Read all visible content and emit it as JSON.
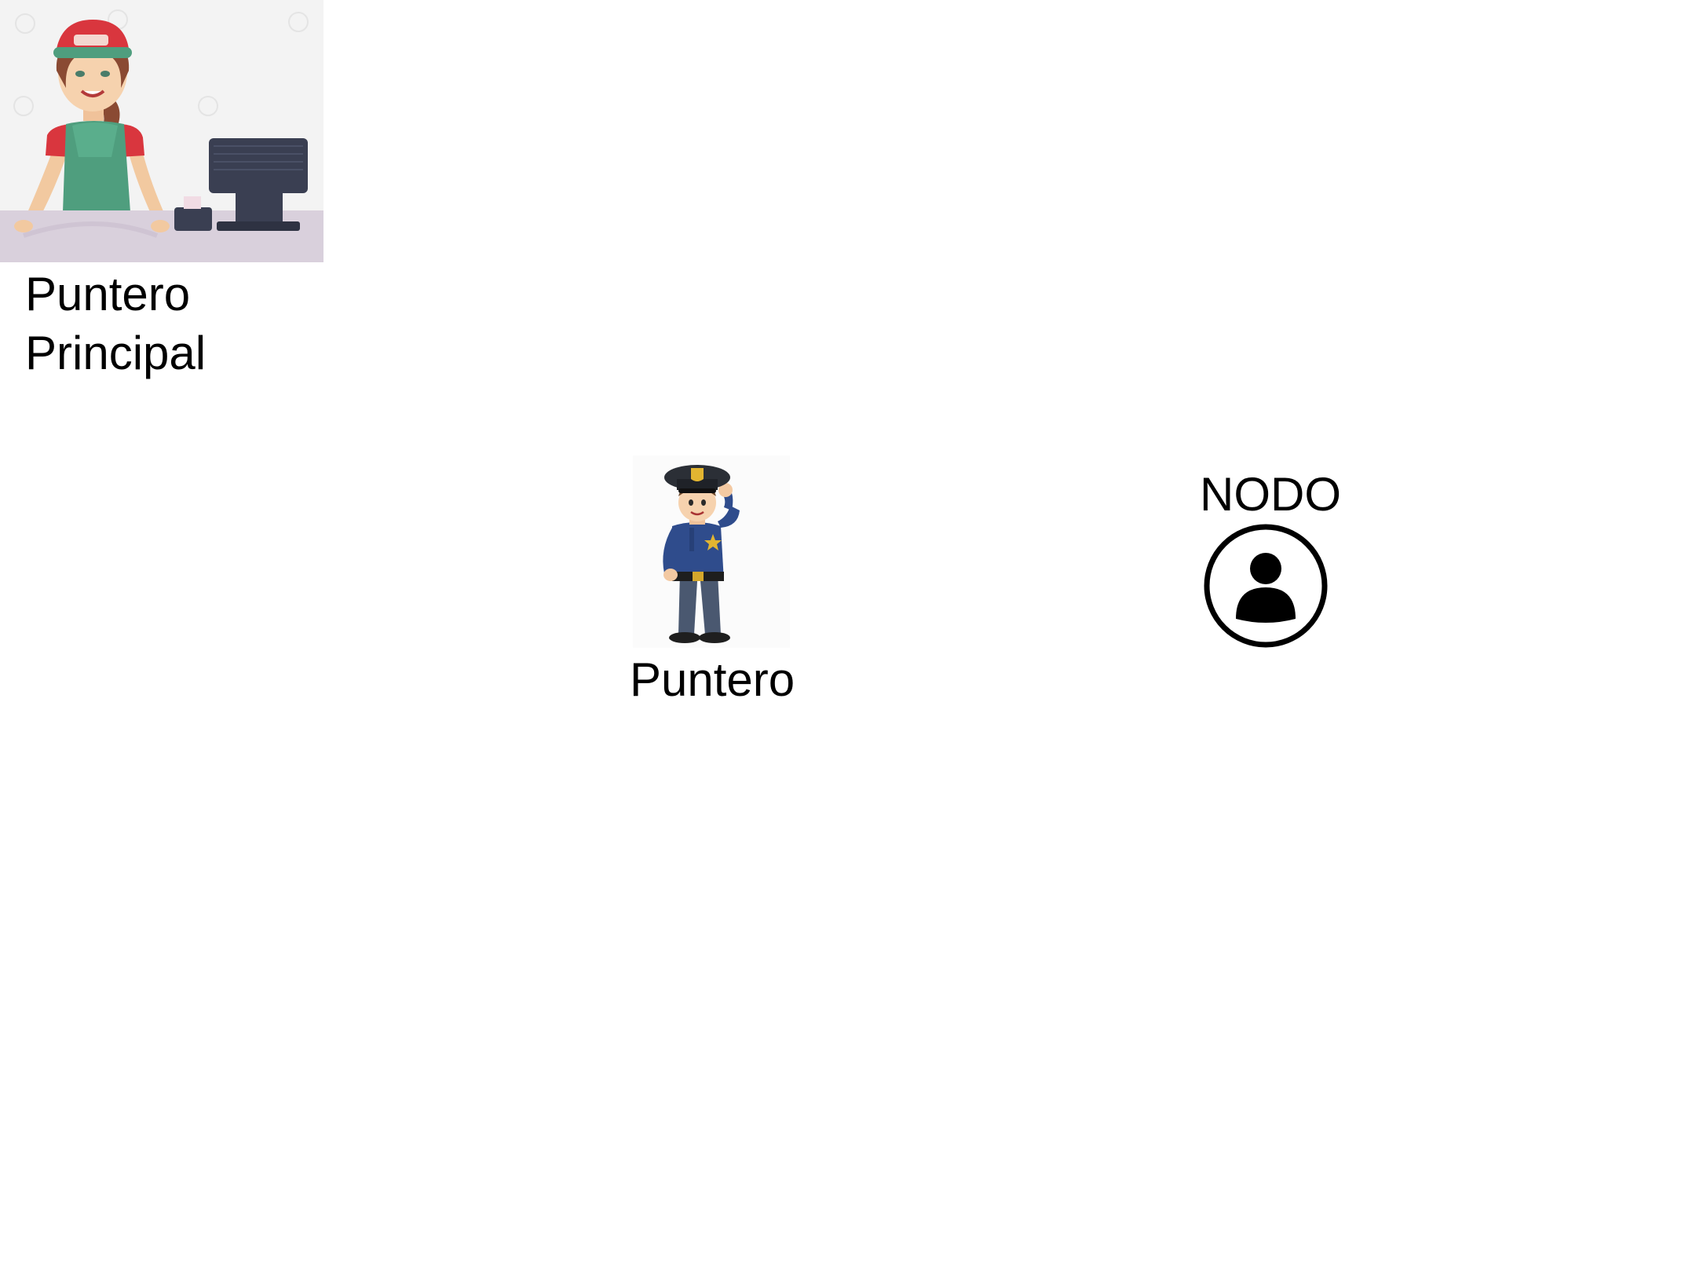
{
  "diagram": {
    "puntero_principal": {
      "label_line1": "Puntero",
      "label_line2": "Principal",
      "illustration": "cashier-illustration"
    },
    "puntero": {
      "label": "Puntero",
      "illustration": "police-officer-illustration"
    },
    "nodo": {
      "label": "NODO",
      "icon": "user-circle-icon"
    }
  },
  "colors": {
    "cap_red": "#d9363e",
    "apron_green": "#4f9e7e",
    "counter_lilac": "#d9d0dc",
    "register_navy": "#3a3f52",
    "uniform_blue": "#2f4c8c",
    "icon_black": "#000000"
  }
}
